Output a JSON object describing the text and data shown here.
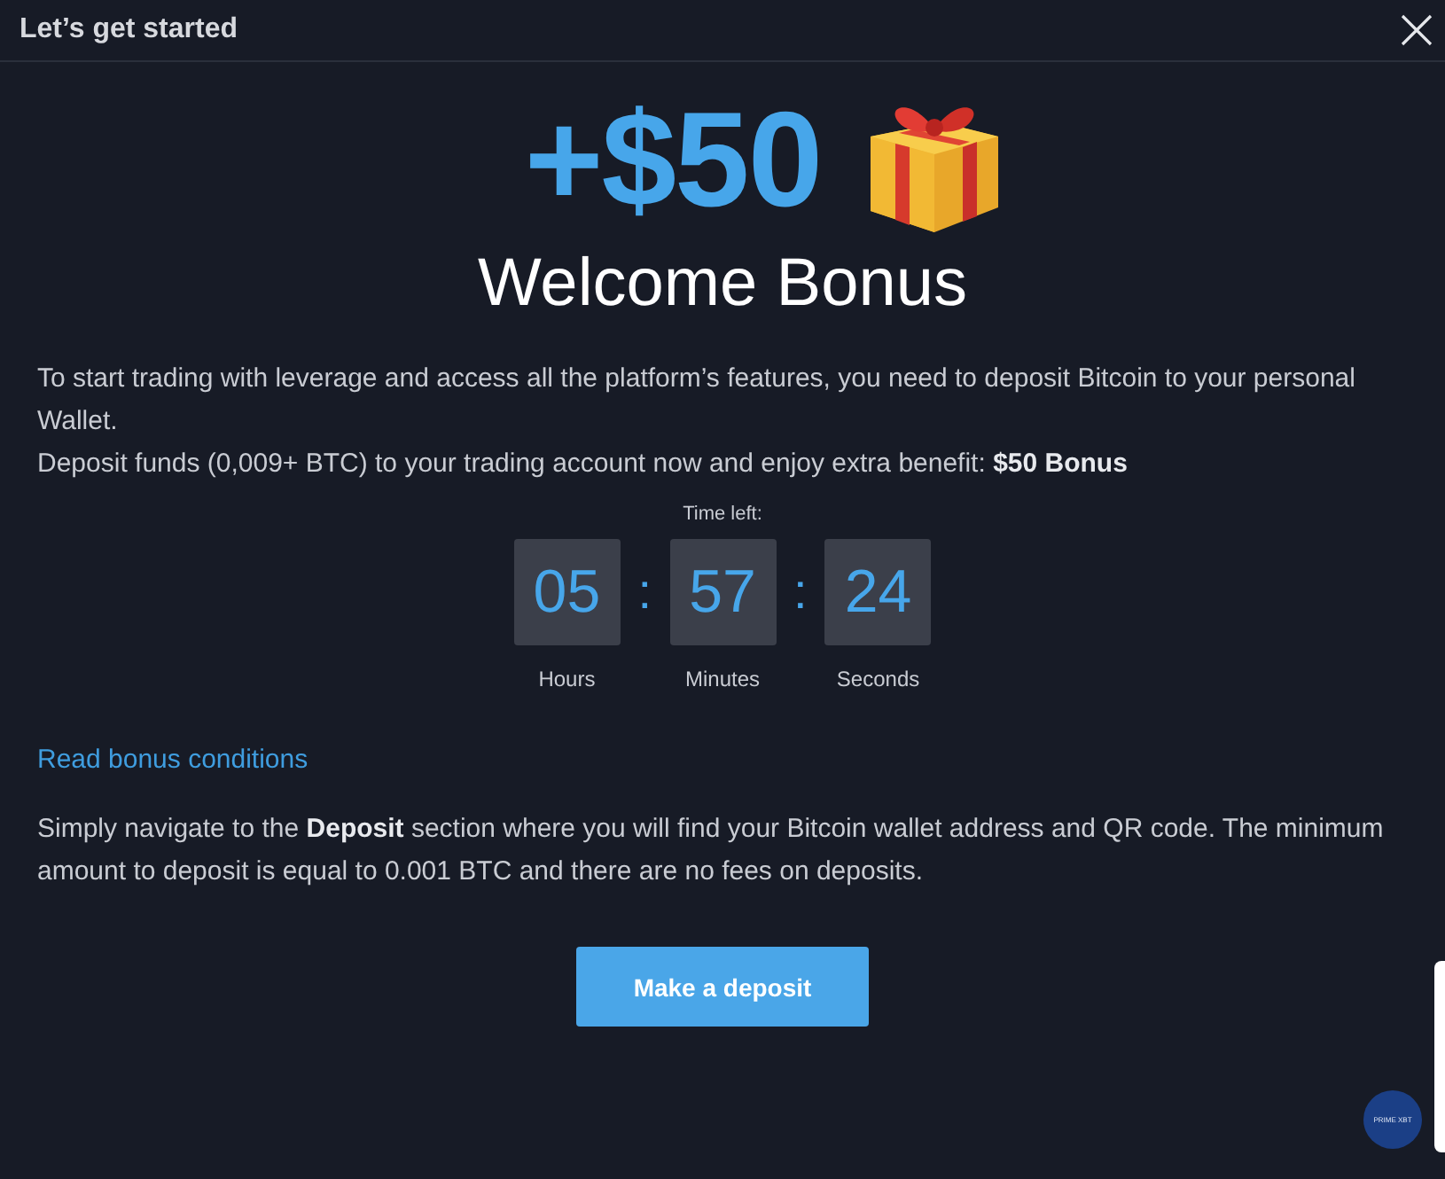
{
  "window": {
    "title": "Let’s get started"
  },
  "bonus": {
    "amount": "+$50",
    "title": "Welcome Bonus"
  },
  "intro": [
    "To start trading with leverage and access all the platform’s features, you need to deposit Bitcoin to your personal Wallet.",
    "Deposit funds (0,009+ BTC) to your trading account now and enjoy extra benefit: **$50 Bonus**"
  ],
  "timer": {
    "label": "Time left:",
    "units": [
      {
        "value": "05",
        "label": "Hours"
      },
      {
        "value": "57",
        "label": "Minutes"
      },
      {
        "value": "24",
        "label": "Seconds"
      }
    ],
    "separator": ":"
  },
  "conditions_link": "Read bonus conditions",
  "instructions": "Simply navigate to the **Deposit** section where you will find your Bitcoin wallet address and QR code. The minimum amount to deposit is equal to 0.001 BTC and there are no fees on deposits.",
  "button": "Make a deposit",
  "badge": "PRIME XBT"
}
